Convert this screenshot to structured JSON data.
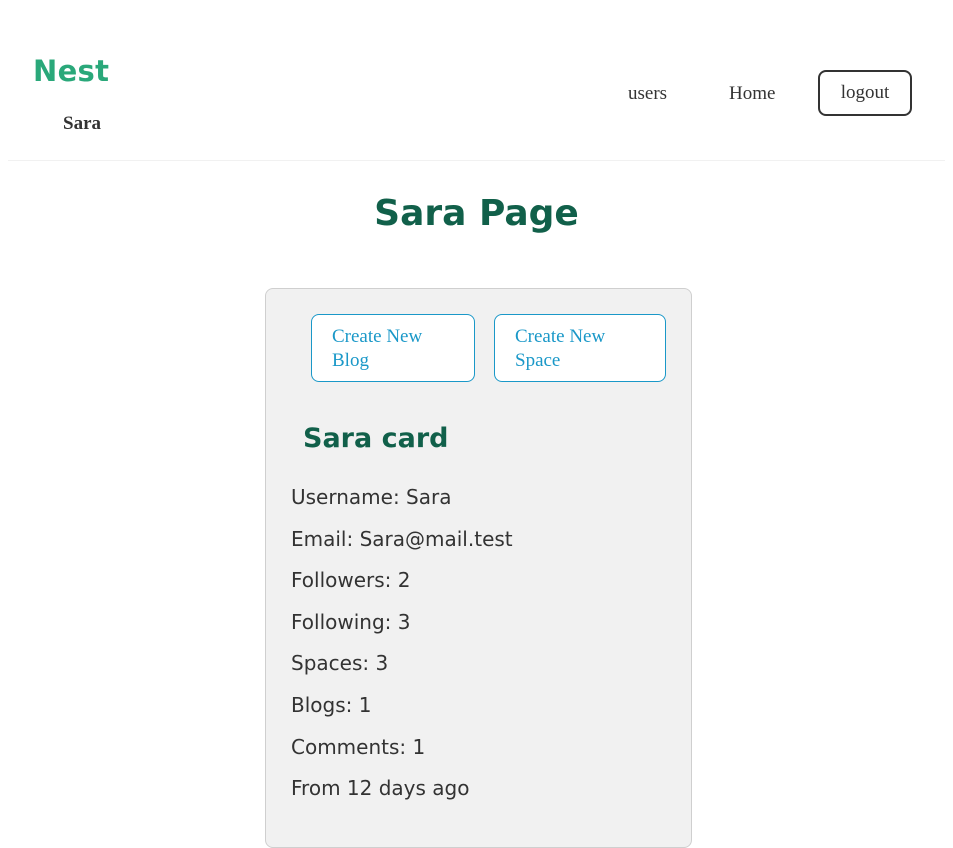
{
  "navbar": {
    "brand": "Nest",
    "current_user": "Sara",
    "links": {
      "users": "users",
      "home": "Home"
    },
    "logout_label": "logout"
  },
  "main": {
    "title": "Sara Page"
  },
  "card": {
    "buttons": {
      "create_blog": "Create New Blog",
      "create_space": "Create New Space"
    },
    "title": "Sara card",
    "info": [
      "Username: Sara",
      "Email: Sara@mail.test",
      "Followers: 2",
      "Following: 3",
      "Spaces: 3",
      "Blogs: 1",
      "Comments: 1",
      "From 12 days ago"
    ]
  },
  "colors": {
    "brand": "#2aa87a",
    "heading": "#11604a",
    "accent": "#1a98c8",
    "card_background": "#f1f1f1"
  }
}
